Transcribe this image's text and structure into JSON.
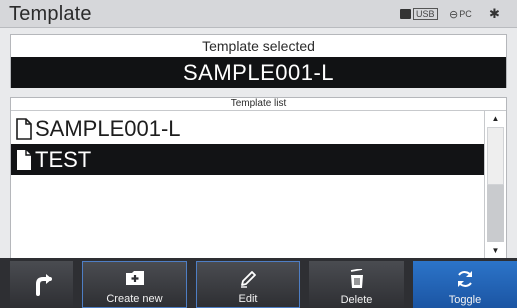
{
  "header": {
    "title": "Template",
    "usb_label": "USB",
    "pc_label": "PC",
    "bluetooth_glyph": "✱"
  },
  "selected": {
    "label": "Template selected",
    "value": "SAMPLE001-L"
  },
  "list": {
    "header": "Template list",
    "items": [
      {
        "name": "SAMPLE001-L",
        "selected": false,
        "icon": "file-outline-icon"
      },
      {
        "name": "TEST",
        "selected": true,
        "icon": "file-filled-icon"
      }
    ],
    "scroll_up_glyph": "▲",
    "scroll_down_glyph": "▼"
  },
  "toolbar": {
    "back_icon": "return-arrow-icon",
    "create_label": "Create new",
    "edit_label": "Edit",
    "delete_label": "Delete",
    "toggle_label": "Toggle"
  },
  "colors": {
    "accent": "#2c74c9",
    "highlight_border": "#4e7ec4",
    "selection_bg": "#121315"
  }
}
